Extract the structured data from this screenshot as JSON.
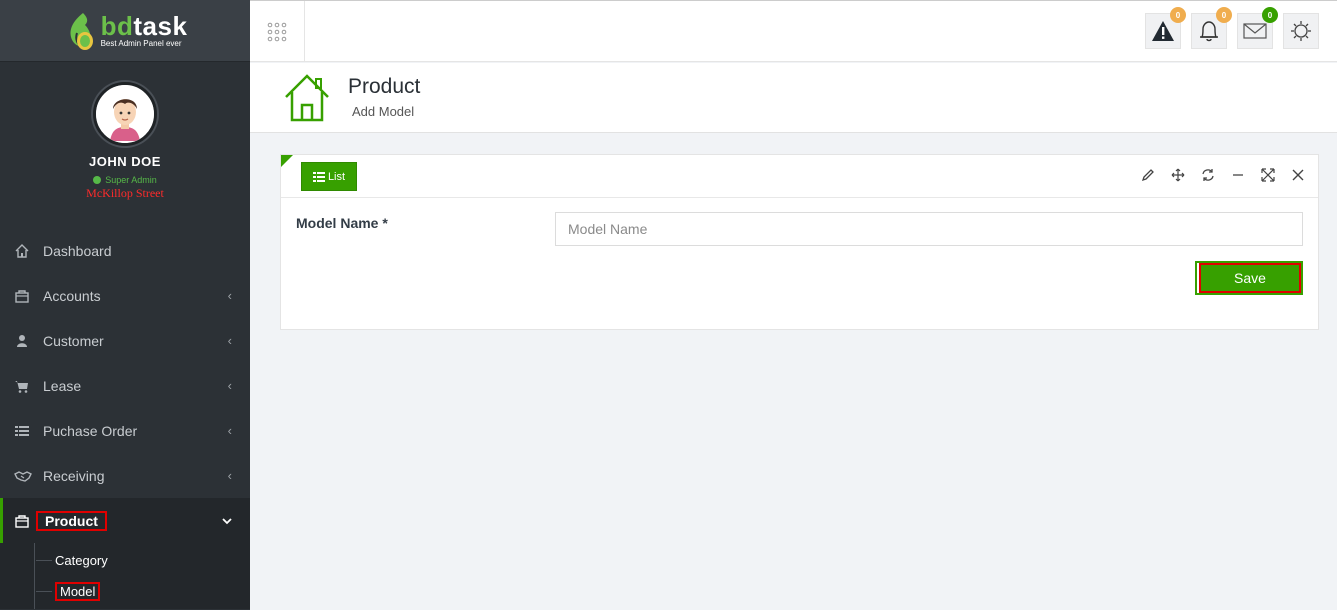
{
  "brand": {
    "name_part1": "bd",
    "name_part2": "task",
    "tagline": "Best Admin Panel ever"
  },
  "user": {
    "name": "JOHN DOE",
    "role": "Super Admin",
    "location": "McKillop Street"
  },
  "sidebar": {
    "items": [
      {
        "label": "Dashboard",
        "icon": "home-icon"
      },
      {
        "label": "Accounts",
        "icon": "briefcase-icon"
      },
      {
        "label": "Customer",
        "icon": "user-icon"
      },
      {
        "label": "Lease",
        "icon": "cart-icon"
      },
      {
        "label": "Puchase Order",
        "icon": "list-icon"
      },
      {
        "label": "Receiving",
        "icon": "handshake-icon"
      },
      {
        "label": "Product",
        "icon": "briefcase-icon",
        "active": true
      }
    ],
    "sub_items": [
      {
        "label": "Category"
      },
      {
        "label": "Model"
      }
    ]
  },
  "header": {
    "badges": {
      "alerts": "0",
      "notifications": "0",
      "messages": "0"
    },
    "colors": {
      "alerts_badge": "#f0ad4e",
      "notifications_badge": "#f0ad4e",
      "messages_badge": "#37a000"
    }
  },
  "page": {
    "title": "Product",
    "subtitle": "Add Model"
  },
  "panel": {
    "list_button": "List",
    "form": {
      "label": "Model Name *",
      "placeholder": "Model Name",
      "value": ""
    },
    "save_button": "Save"
  },
  "colors": {
    "accent": "#37a000",
    "sidebar_bg": "#2c3136",
    "highlight_red": "#e00000"
  }
}
